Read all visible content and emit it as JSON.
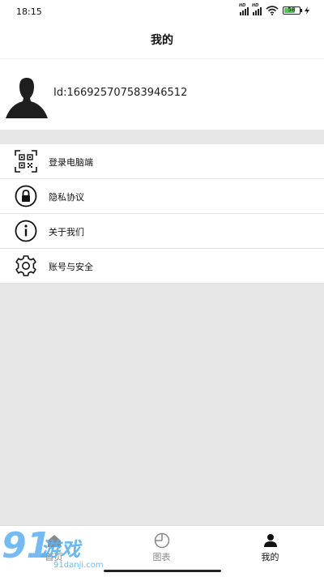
{
  "status_bar": {
    "time": "18:15",
    "battery_level": "58",
    "battery_color": "#58c35a"
  },
  "header": {
    "title": "我的"
  },
  "profile": {
    "user_id": "Id:166925707583946512"
  },
  "menu": {
    "items": [
      {
        "label": "登录电脑端",
        "icon": "qr-code-icon"
      },
      {
        "label": "隐私协议",
        "icon": "lock-icon"
      },
      {
        "label": "关于我们",
        "icon": "info-icon"
      },
      {
        "label": "账号与安全",
        "icon": "gear-icon"
      }
    ]
  },
  "tabbar": {
    "tabs": [
      {
        "label": "首页",
        "icon": "home-icon",
        "active": false
      },
      {
        "label": "图表",
        "icon": "chart-icon",
        "active": false
      },
      {
        "label": "我的",
        "icon": "person-icon",
        "active": true
      }
    ]
  },
  "watermark": {
    "logo_number": "91",
    "brand": "游戏",
    "site": "91danji.com",
    "color": "#5bb0f0"
  }
}
